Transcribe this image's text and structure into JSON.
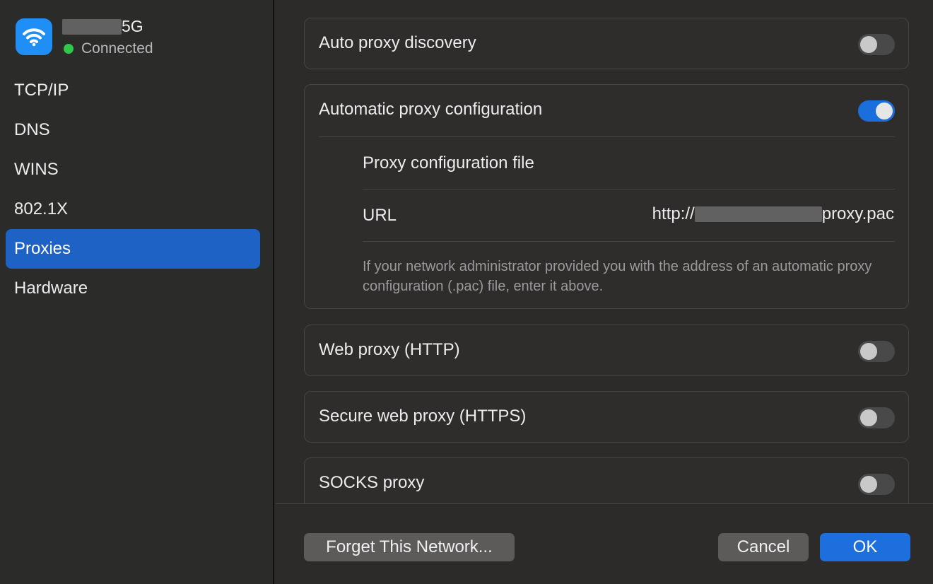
{
  "network": {
    "name_suffix": "5G",
    "status": "Connected",
    "status_color": "#2fc84a"
  },
  "sidebar": {
    "items": [
      {
        "label": "TCP/IP"
      },
      {
        "label": "DNS"
      },
      {
        "label": "WINS"
      },
      {
        "label": "802.1X"
      },
      {
        "label": "Proxies",
        "selected": true
      },
      {
        "label": "Hardware"
      }
    ]
  },
  "proxies": {
    "auto_discovery": {
      "label": "Auto proxy discovery",
      "enabled": false
    },
    "auto_config": {
      "label": "Automatic proxy configuration",
      "enabled": true,
      "file_label": "Proxy configuration file",
      "url_label": "URL",
      "url_prefix": "http://",
      "url_suffix": "proxy.pac",
      "help_text": "If your network administrator provided you with the address of an automatic proxy configuration (.pac) file, enter it above."
    },
    "web_proxy": {
      "label": "Web proxy (HTTP)",
      "enabled": false
    },
    "secure_web_proxy": {
      "label": "Secure web proxy (HTTPS)",
      "enabled": false
    },
    "socks_proxy": {
      "label": "SOCKS proxy",
      "enabled": false
    }
  },
  "footer": {
    "forget_label": "Forget This Network...",
    "cancel_label": "Cancel",
    "ok_label": "OK"
  },
  "colors": {
    "accent": "#1d62c4",
    "toggle_on": "#1b6fdc",
    "primary_button": "#1d6fde"
  }
}
